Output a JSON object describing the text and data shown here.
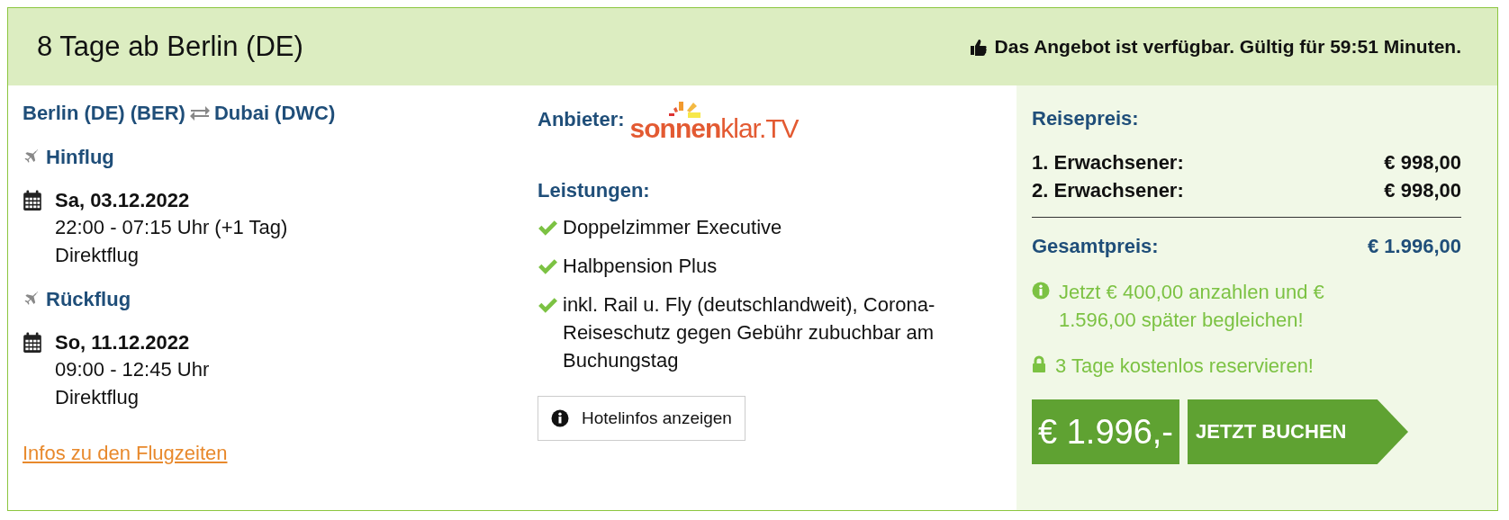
{
  "header": {
    "title": "8 Tage ab Berlin (DE)",
    "availability": "Das Angebot ist verfügbar. Gültig für 59:51 Minuten."
  },
  "flights": {
    "origin": "Berlin (DE) (BER)",
    "destination": "Dubai (DWC)",
    "legs": [
      {
        "label": "Hinflug",
        "date": "Sa, 03.12.2022",
        "times": "22:00 - 07:15 Uhr (+1 Tag)",
        "type": "Direktflug"
      },
      {
        "label": "Rückflug",
        "date": "So, 11.12.2022",
        "times": "09:00 - 12:45 Uhr",
        "type": "Direktflug"
      }
    ],
    "link": "Infos zu den Flugzeiten"
  },
  "offer": {
    "provider_label": "Anbieter:",
    "provider_logo": "**sonnen**klar.TV",
    "services_label": "Leistungen:",
    "services": [
      "Doppelzimmer Executive",
      "Halbpension Plus",
      "inkl. Rail u. Fly (deutschlandweit), Corona-Reiseschutz gegen Gebühr zubuchbar am Buchungstag"
    ],
    "hotel_button": "Hotelinfos anzeigen"
  },
  "price": {
    "title": "Reisepreis:",
    "lines": [
      {
        "label": "1. Erwachsener:",
        "amount": "€ 998,00"
      },
      {
        "label": "2. Erwachsener:",
        "amount": "€ 998,00"
      }
    ],
    "total_label": "Gesamtpreis:",
    "total": "€ 1.996,00",
    "deposit_note": "Jetzt € 400,00 anzahlen und € 1.596,00 später begleichen!",
    "reserve_note": "3 Tage kostenlos reservieren!",
    "price_tag": "€ 1.996,-",
    "book_button": "JETZT BUCHEN"
  }
}
